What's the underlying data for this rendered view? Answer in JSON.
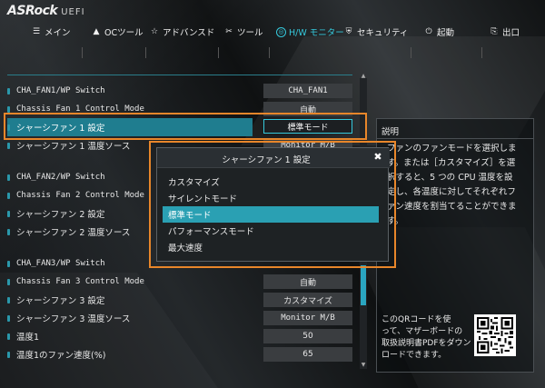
{
  "brand": {
    "logo": "ASRock",
    "suffix": "UEFI"
  },
  "nav": [
    {
      "id": "main",
      "icon": "☰",
      "label": "メイン"
    },
    {
      "id": "oc",
      "icon": "▲",
      "label": "OCツール"
    },
    {
      "id": "advanced",
      "icon": "☆",
      "label": "アドバンスド"
    },
    {
      "id": "tool",
      "icon": "✂",
      "label": "ツール"
    },
    {
      "id": "hw",
      "icon": "◎",
      "label": "H/W モニター",
      "active": true
    },
    {
      "id": "security",
      "icon": "⛨",
      "label": "セキュリティ"
    },
    {
      "id": "boot",
      "icon": "⏻",
      "label": "起動"
    },
    {
      "id": "exit",
      "icon": "⎘",
      "label": "出口"
    }
  ],
  "settings": [
    {
      "label": "CHA_FAN1/WP Switch",
      "value": "CHA_FAN1",
      "mono": true
    },
    {
      "label": "Chassis Fan 1 Control Mode",
      "value": "自動",
      "mono": true
    },
    {
      "label": "シャーシファン 1 設定",
      "value": "標準モード",
      "highlight": true
    },
    {
      "label": "シャーシファン 1 温度ソース",
      "value": "Monitor M/B"
    },
    {
      "label": "CHA_FAN2/WP Switch",
      "value": "",
      "mono": true
    },
    {
      "label": "Chassis Fan 2 Control Mode",
      "value": "",
      "mono": true
    },
    {
      "label": "シャーシファン 2 設定",
      "value": ""
    },
    {
      "label": "シャーシファン 2 温度ソース",
      "value": ""
    },
    {
      "label": "CHA_FAN3/WP Switch",
      "value": "",
      "mono": true
    },
    {
      "label": "Chassis Fan 3 Control Mode",
      "value": "自動",
      "mono": true
    },
    {
      "label": "シャーシファン 3 設定",
      "value": "カスタマイズ"
    },
    {
      "label": "シャーシファン 3 温度ソース",
      "value": "Monitor M/B"
    },
    {
      "label": "温度1",
      "value": "50"
    },
    {
      "label": "温度1のファン速度(%)",
      "value": "65"
    }
  ],
  "description": {
    "title": "説明",
    "text": "ファンのファンモードを選択しま\nす。または［カスタマイズ］を選\n択すると、5 つの CPU 温度を設\n定し、各温度に対してそれぞれフ\nァン速度を割当てることができま\nす。",
    "qr_text": "このQRコードを使\nって、マザーボードの\n取扱説明書PDFをダウン\nロードできます。"
  },
  "popup": {
    "title": "シャーシファン 1 設定",
    "options": [
      "カスタマイズ",
      "サイレントモード",
      "標準モード",
      "パフォーマンスモード",
      "最大速度"
    ],
    "selected_index": 2
  }
}
